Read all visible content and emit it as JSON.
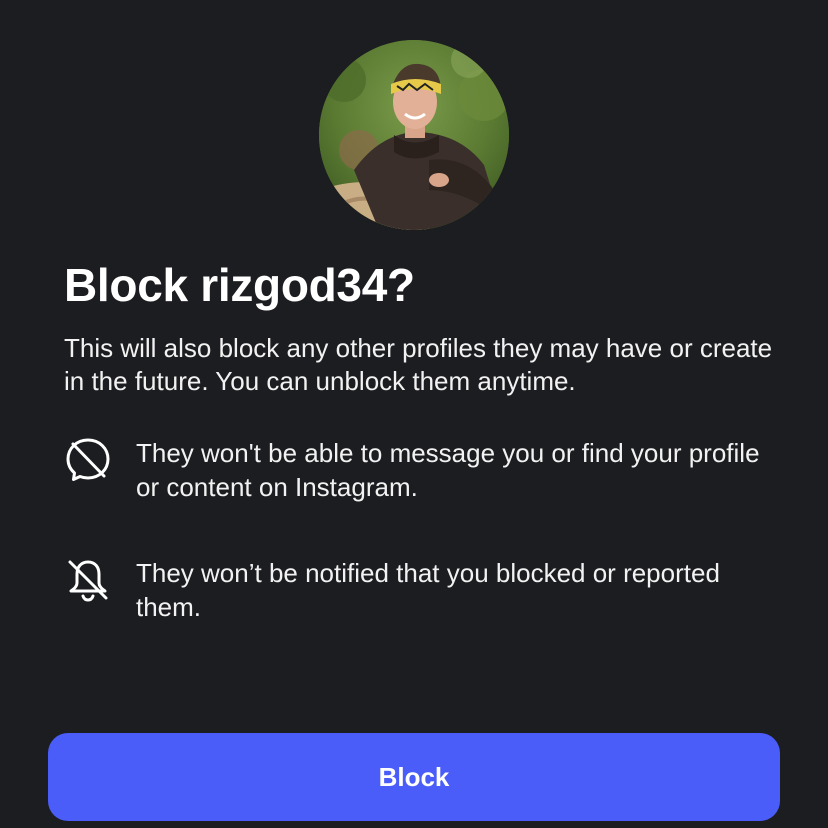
{
  "dialog": {
    "title": "Block rizgod34?",
    "subtitle": "This will also block any other profiles they may have or create in the future. You can unblock them anytime.",
    "avatar_icon": "profile-photo",
    "items": [
      {
        "icon": "no-message-icon",
        "text": "They won't be able to message you or find your profile or content on Instagram."
      },
      {
        "icon": "notifications-off-icon",
        "text": "They won’t be notified that you blocked or reported them."
      }
    ],
    "block_button_label": "Block"
  },
  "colors": {
    "background": "#1c1d20",
    "button": "#4a5df9",
    "text": "#ffffff"
  }
}
